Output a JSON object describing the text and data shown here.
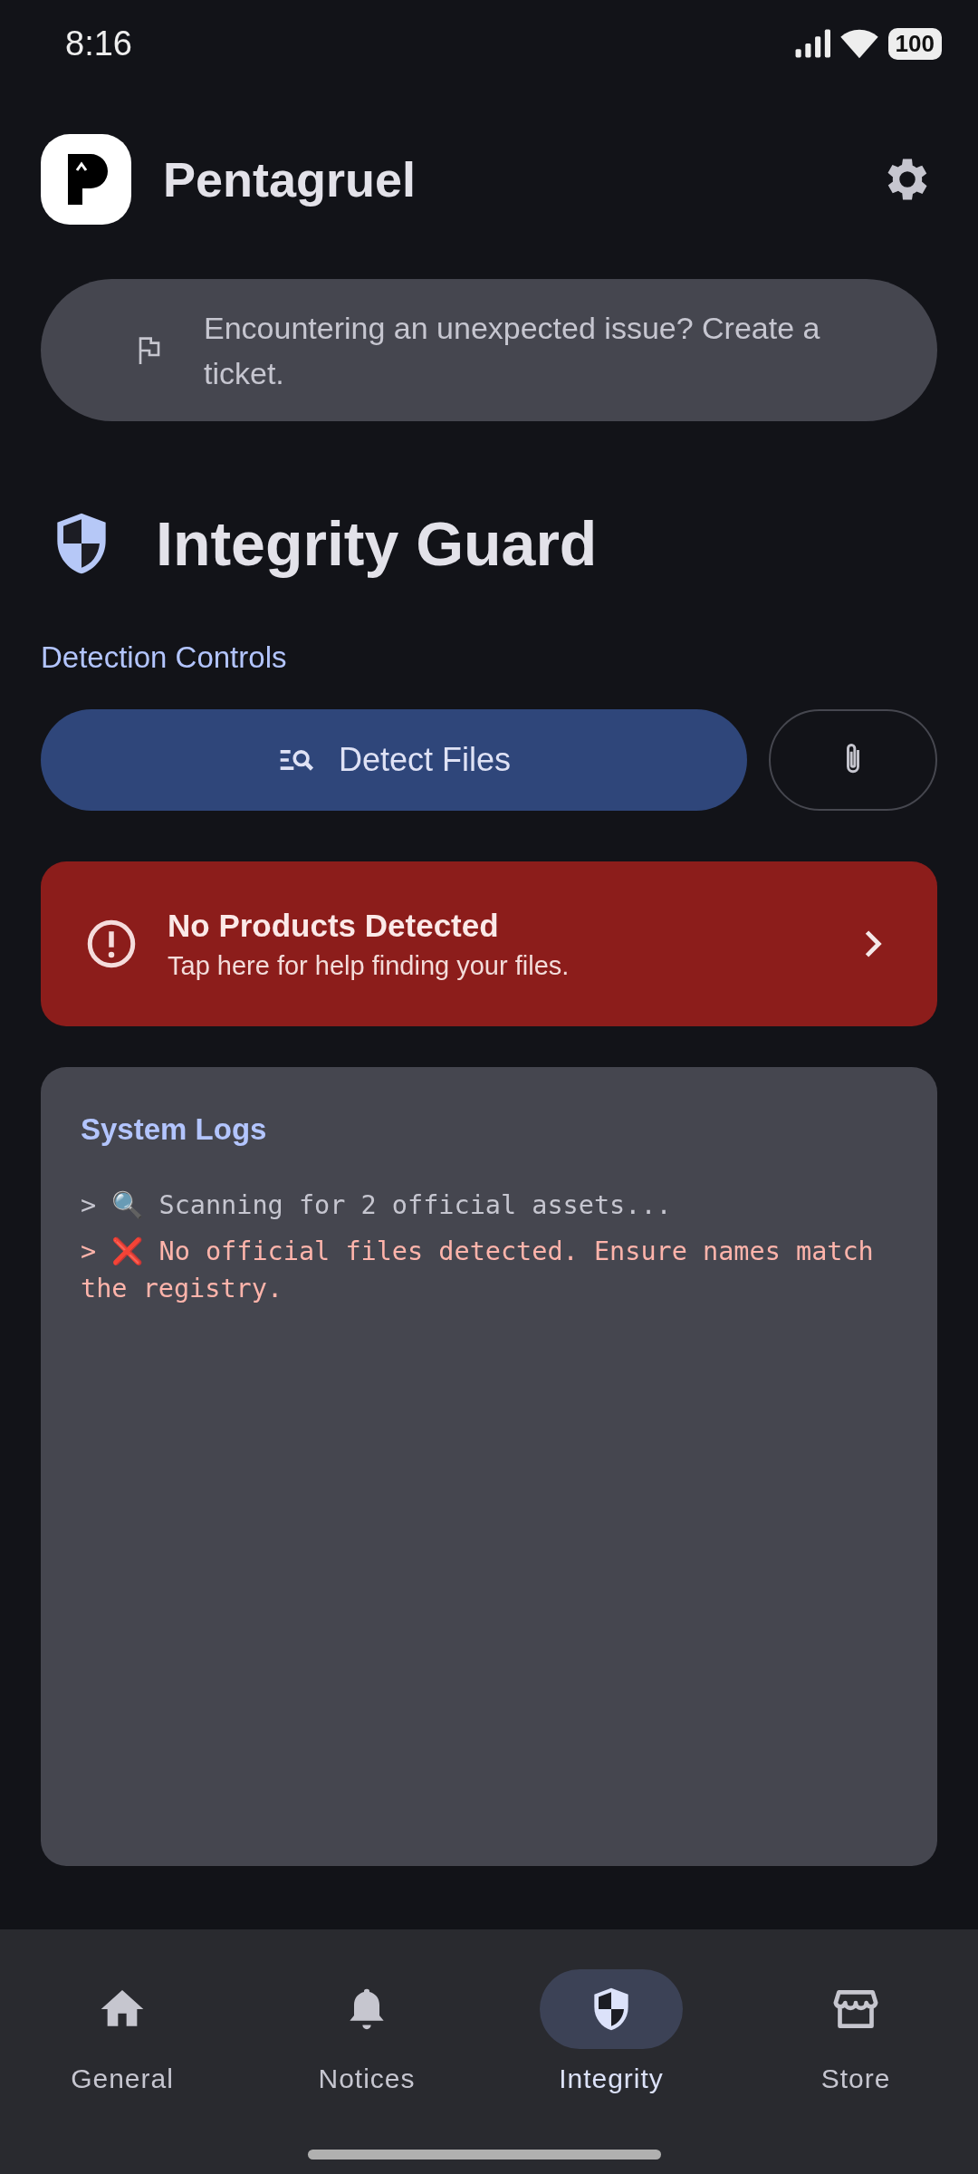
{
  "status_bar": {
    "time": "8:16",
    "battery": "100"
  },
  "app_bar": {
    "title": "Pentagruel"
  },
  "ticket_banner": {
    "text": "Encountering an unexpected issue? Create a ticket."
  },
  "page_title": "Integrity Guard",
  "section_label": "Detection Controls",
  "detect_button": {
    "label": "Detect Files"
  },
  "alert": {
    "title": "No Products Detected",
    "subtitle": "Tap here for help finding your files."
  },
  "logs": {
    "title": "System Logs",
    "lines": [
      {
        "kind": "info",
        "text": "> 🔍 Scanning for 2 official assets..."
      },
      {
        "kind": "error",
        "text": "> ❌ No official files detected. Ensure names match the registry."
      }
    ]
  },
  "nav": [
    {
      "label": "General",
      "selected": false
    },
    {
      "label": "Notices",
      "selected": false
    },
    {
      "label": "Integrity",
      "selected": true
    },
    {
      "label": "Store",
      "selected": false
    }
  ]
}
